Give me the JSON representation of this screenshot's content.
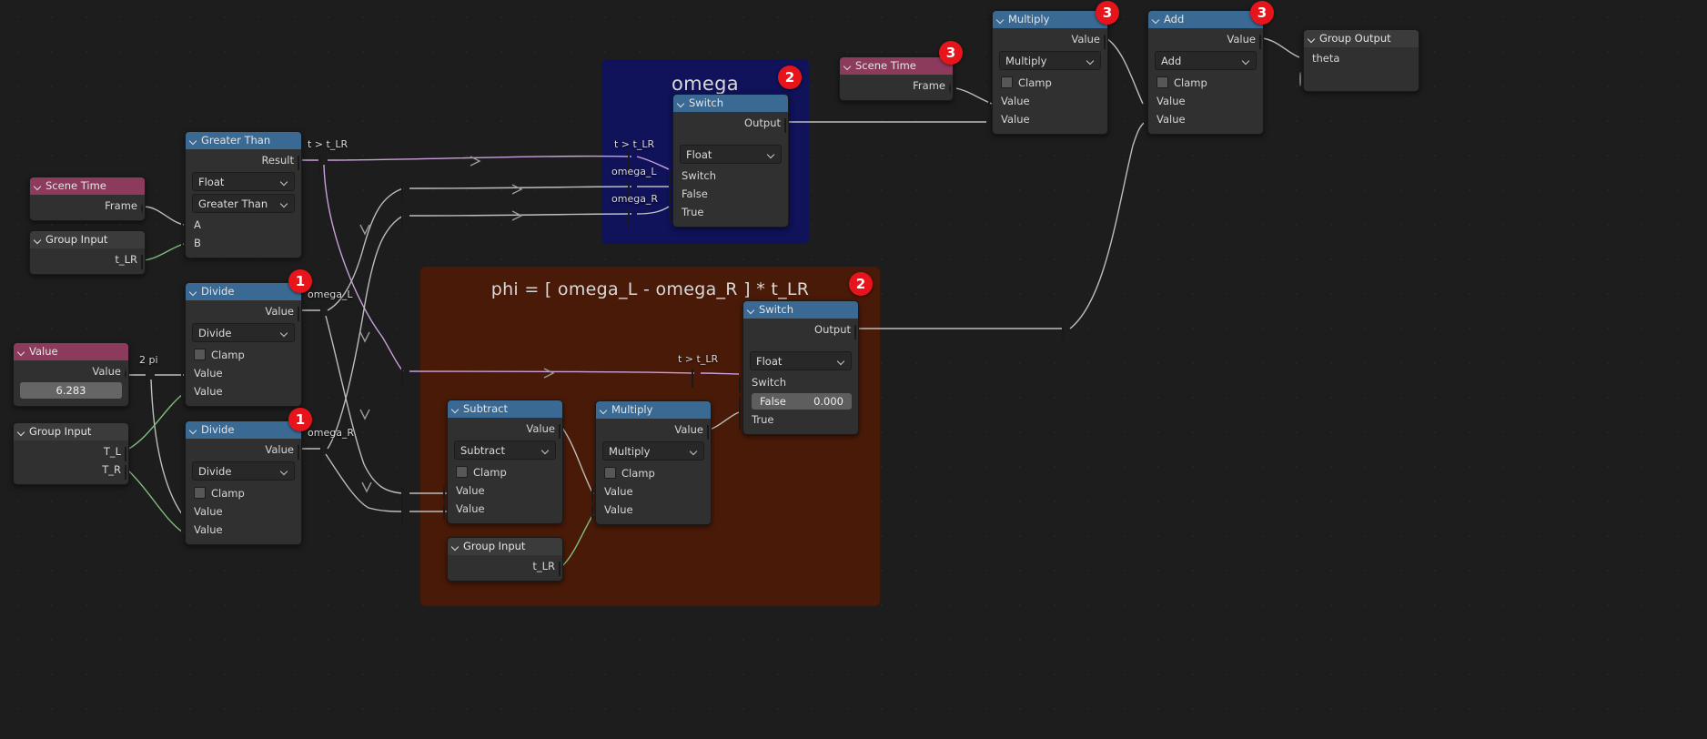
{
  "editor": {
    "background_color": "#1d1d1d"
  },
  "frames": [
    {
      "name": "omega",
      "label": "omega",
      "color": "#10125a",
      "badge": "2"
    },
    {
      "name": "phi",
      "label": "phi = [ omega_L - omega_R ] * t_LR",
      "color": "#4a1a08",
      "badge": "2"
    }
  ],
  "nodes": {
    "scene_time_left": {
      "title": "Scene Time",
      "outputs": [
        "Frame"
      ]
    },
    "group_input_tlr": {
      "title": "Group Input",
      "outputs": [
        "t_LR"
      ]
    },
    "greater_than": {
      "title": "Greater Than",
      "outputs": [
        "Result"
      ],
      "dropdowns": [
        "Float",
        "Greater Than"
      ],
      "inputs": [
        "A",
        "B"
      ]
    },
    "value_2pi": {
      "title": "Value",
      "outputs": [
        "Value"
      ],
      "value": "6.283"
    },
    "group_input_tltr": {
      "title": "Group Input",
      "outputs": [
        "T_L",
        "T_R"
      ]
    },
    "divide_l": {
      "title": "Divide",
      "badge": "1",
      "outputs": [
        "Value"
      ],
      "dropdowns": [
        "Divide"
      ],
      "clamp_label": "Clamp",
      "inputs": [
        "Value",
        "Value"
      ]
    },
    "divide_r": {
      "title": "Divide",
      "badge": "1",
      "outputs": [
        "Value"
      ],
      "dropdowns": [
        "Divide"
      ],
      "clamp_label": "Clamp",
      "inputs": [
        "Value",
        "Value"
      ]
    },
    "switch_omega": {
      "title": "Switch",
      "outputs": [
        "Output"
      ],
      "dropdowns": [
        "Float"
      ],
      "inputs": [
        "Switch",
        "False",
        "True"
      ]
    },
    "scene_time_right": {
      "title": "Scene Time",
      "badge": "3",
      "outputs": [
        "Frame"
      ]
    },
    "multiply_top": {
      "title": "Multiply",
      "badge": "3",
      "outputs": [
        "Value"
      ],
      "dropdowns": [
        "Multiply"
      ],
      "clamp_label": "Clamp",
      "inputs": [
        "Value",
        "Value"
      ]
    },
    "add_top": {
      "title": "Add",
      "badge": "3",
      "outputs": [
        "Value"
      ],
      "dropdowns": [
        "Add"
      ],
      "clamp_label": "Clamp",
      "inputs": [
        "Value",
        "Value"
      ]
    },
    "group_output": {
      "title": "Group Output",
      "inputs": [
        "theta"
      ]
    },
    "switch_phi": {
      "title": "Switch",
      "outputs": [
        "Output"
      ],
      "dropdowns": [
        "Float"
      ],
      "inputs": [
        "Switch",
        "True"
      ],
      "false_field_label": "False",
      "false_field_value": "0.000"
    },
    "subtract": {
      "title": "Subtract",
      "outputs": [
        "Value"
      ],
      "dropdowns": [
        "Subtract"
      ],
      "clamp_label": "Clamp",
      "inputs": [
        "Value",
        "Value"
      ]
    },
    "multiply_phi": {
      "title": "Multiply",
      "outputs": [
        "Value"
      ],
      "dropdowns": [
        "Multiply"
      ],
      "clamp_label": "Clamp",
      "inputs": [
        "Value",
        "Value"
      ]
    },
    "group_input_phi": {
      "title": "Group Input",
      "outputs": [
        "t_LR"
      ]
    }
  },
  "reroute_labels": {
    "t_gt_tlr_main": "t > t_LR",
    "omega_l_left": "omega_L",
    "omega_r_left": "omega_R",
    "two_pi": "2 pi",
    "t_gt_tlr_omega": "t > t_LR",
    "omega_l_omega": "omega_L",
    "omega_r_omega": "omega_R",
    "t_gt_tlr_phi": "t > t_LR"
  },
  "colors": {
    "header_math": "#3a6a94",
    "header_input": "#8c3b5c",
    "header_grey": "#3b3b3b",
    "badge": "#e8141b",
    "frame_omega": "#10125a",
    "frame_phi": "#4a1a08",
    "socket_float": "#9b9b9b",
    "socket_bool": "#cf9ce0",
    "socket_green": "#62c262"
  }
}
